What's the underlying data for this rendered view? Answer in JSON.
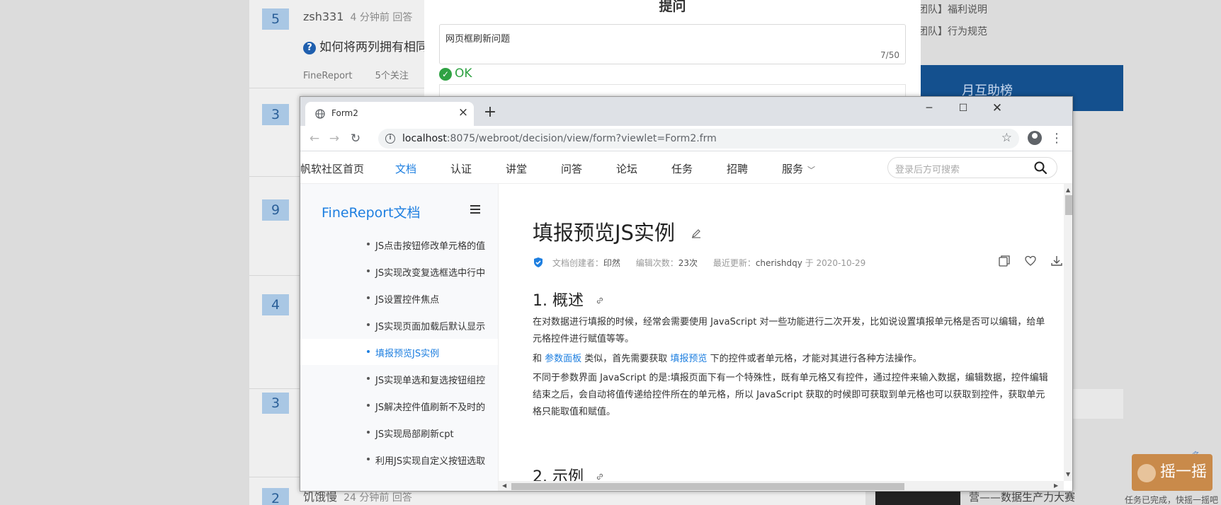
{
  "background": {
    "rows": [
      {
        "num": "5",
        "user": "zsh331",
        "time": "4 分钟前 回答",
        "question": "如何将两列拥有相同",
        "tags": [
          "FineReport",
          "5个关注"
        ]
      },
      {
        "num": "3"
      },
      {
        "num": "9"
      },
      {
        "num": "4"
      },
      {
        "num": "3"
      },
      {
        "num": "2",
        "user": "饥饿慢",
        "time": "24 分钟前 回答"
      }
    ],
    "right_links": [
      "团队】福利说明",
      "团队】行为规范"
    ],
    "banner_text": "月互助榜",
    "more_text": "多",
    "lottery_label": "摇一摇",
    "lottery_hint": "任务已完成，快摇一摇吧",
    "bottom_text": "营——数据生产力大赛"
  },
  "modal": {
    "title": "提问",
    "input_value": "网页框刷新问题",
    "char_count": "7/50",
    "ok_label": "OK"
  },
  "browser": {
    "tab_title": "Form2",
    "url_host": "localhost",
    "url_rest": ":8075/webroot/decision/view/form?viewlet=Form2.frm"
  },
  "site": {
    "nav": [
      {
        "label": "帆软社区首页",
        "active": false
      },
      {
        "label": "文档",
        "active": true
      },
      {
        "label": "认证",
        "active": false
      },
      {
        "label": "讲堂",
        "active": false
      },
      {
        "label": "问答",
        "active": false
      },
      {
        "label": "论坛",
        "active": false
      },
      {
        "label": "任务",
        "active": false
      },
      {
        "label": "招聘",
        "active": false
      },
      {
        "label": "服务",
        "active": false
      }
    ],
    "search_placeholder": "登录后方可搜索",
    "sidebar_title": "FineReport文档",
    "sidebar_items": [
      "JS点击按钮修改单元格的值",
      "JS实现改变复选框选中行中",
      "JS设置控件焦点",
      "JS实现页面加载后默认显示",
      "填报预览JS实例",
      "JS实现单选和复选按钮组控",
      "JS解决控件值刷新不及时的",
      "JS实现局部刷新cpt",
      "利用JS实现自定义按钮选取"
    ],
    "sidebar_active_index": 4
  },
  "article": {
    "title": "填报预览JS实例",
    "meta": {
      "creator_label": "文档创建者：",
      "creator": "印然",
      "edits_label": "编辑次数：",
      "edits": "23次",
      "updated_label": "最近更新：",
      "updated_by": "cherishdqy",
      "updated_on": "于 2020-10-29"
    },
    "section1_title": "1. 概述",
    "p1": "在对数据进行填报的时候，经常会需要使用 JavaScript 对一些功能进行二次开发，比如说设置填报单元格是否可以编辑，给单元格控件进行赋值等等。",
    "p2_pre": "和 ",
    "p2_link1": "参数面板",
    "p2_mid": " 类似，首先需要获取 ",
    "p2_link2": "填报预览",
    "p2_post": " 下的控件或者单元格，才能对其进行各种方法操作。",
    "p3": "不同于参数界面 JavaScript 的是:填报页面下有一个特殊性，既有单元格又有控件，通过控件来输入数据，编辑数据，控件编辑结束之后，会自动将值传递给控件所在的单元格，所以 JavaScript 获取的时候即可获取到单元格也可以获取到控件，获取单元格只能取值和赋值。",
    "section2_title": "2. 示例"
  }
}
